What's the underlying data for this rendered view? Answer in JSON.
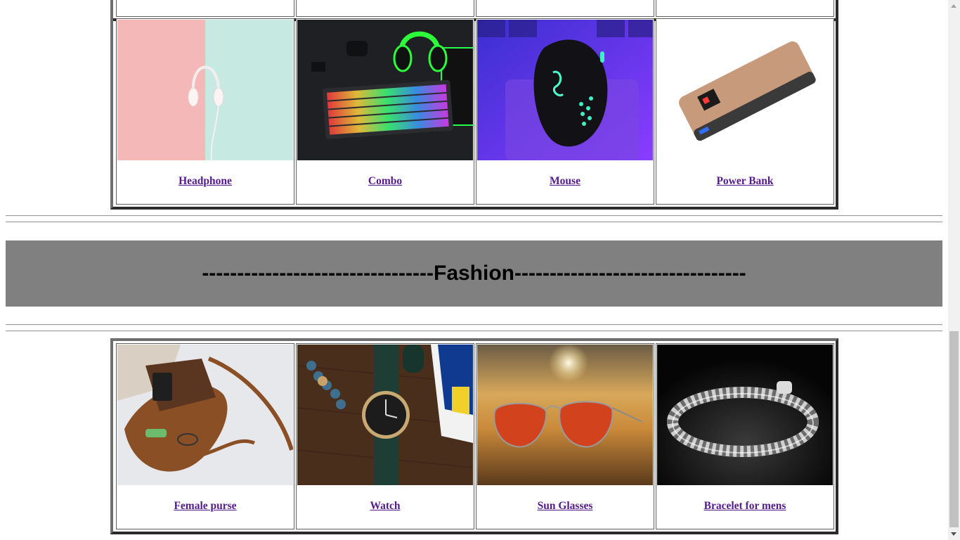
{
  "electronics": {
    "products": [
      {
        "name": "Headphone",
        "image": "headphone-photo"
      },
      {
        "name": "Combo",
        "image": "keyboard-combo-photo"
      },
      {
        "name": "Mouse",
        "image": "gaming-mouse-photo"
      },
      {
        "name": "Power Bank",
        "image": "power-bank-photo"
      }
    ]
  },
  "fashion": {
    "heading": "---------------------------------Fashion---------------------------------",
    "products": [
      {
        "name": "Female purse",
        "image": "purse-photo"
      },
      {
        "name": "Watch",
        "image": "watch-photo"
      },
      {
        "name": "Sun Glasses",
        "image": "sunglasses-photo"
      },
      {
        "name": "Bracelet for mens",
        "image": "bracelet-photo"
      }
    ]
  },
  "colors": {
    "link": "#551a8b",
    "banner": "#808080",
    "table_border_dark": "#2b2b2b",
    "table_border_light": "#6e6e6e"
  }
}
